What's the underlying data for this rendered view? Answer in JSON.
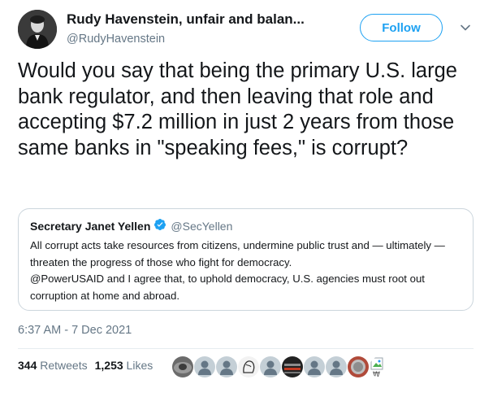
{
  "tweet": {
    "author": {
      "name": "Rudy Havenstein, unfair and balan...",
      "handle": "@RudyHavenstein"
    },
    "follow_label": "Follow",
    "text": "Would you say that being the primary U.S. large bank regulator, and then leaving that role and accepting $7.2 million in just 2 years from those same banks in \"speaking fees,\" is corrupt?",
    "quoted": {
      "name": "Secretary Janet Yellen",
      "handle": "@SecYellen",
      "line1": "All corrupt acts take resources from citizens, undermine public trust and — ultimately — threaten the progress of those who fight for democracy.",
      "line2": "@PowerUSAID and I agree that, to uphold democracy, U.S. agencies must root out corruption at home and abroad."
    },
    "timestamp": "6:37 AM - 7 Dec 2021",
    "stats": {
      "retweets_count": "344",
      "retweets_label": "Retweets",
      "likes_count": "1,253",
      "likes_label": "Likes"
    },
    "likers_count": 10
  },
  "icons": {
    "verified": "verified-badge-icon",
    "menu": "chevron-down-icon"
  },
  "colors": {
    "accent": "#1da1f2",
    "secondary_text": "#657786",
    "border": "#ccd6dd",
    "default_avatar": "#c4cfd6"
  }
}
